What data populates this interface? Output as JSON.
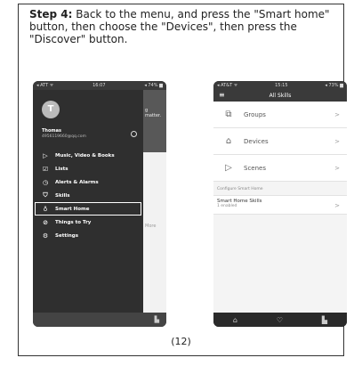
{
  "instruction": {
    "step": "Step 4:",
    "text": " Back to the menu, and press the \"Smart home\" button, then choose the \"Devices\", then press the \"Discover\" button."
  },
  "phone1": {
    "status_left": "◂ ATT ᯤ",
    "status_time": "16:07",
    "status_right": "◂ 74% ▆",
    "avatar_letter": "T",
    "user_name": "Thomas",
    "user_email": "4956119660@qq.com",
    "behind_text": "g matter.",
    "behind_more": "More",
    "menu": [
      {
        "icon": "▷",
        "label": "Music, Video & Books"
      },
      {
        "icon": "☑",
        "label": "Lists"
      },
      {
        "icon": "◷",
        "label": "Alerts & Alarms"
      },
      {
        "icon": "⛉",
        "label": "Skills"
      },
      {
        "icon": "♁",
        "label": "Smart Home"
      },
      {
        "icon": "⊘",
        "label": "Things to Try"
      },
      {
        "icon": "⚙",
        "label": "Settings"
      }
    ],
    "bottom_icon": "▙"
  },
  "phone2": {
    "status_left": "◂ AT&T ᯤ",
    "status_time": "15:15",
    "status_right": "◂ 73% ▆",
    "title": "All Skills",
    "menu_icon": "≡",
    "items": [
      {
        "icon": "⧉",
        "label": "Groups",
        "chev": ">"
      },
      {
        "icon": "⌂",
        "label": "Devices",
        "chev": ">"
      },
      {
        "icon": "▷",
        "label": "Scenes",
        "chev": ">"
      }
    ],
    "section": "Configure Smart Home",
    "smart_title": "Smart Home Skills",
    "smart_sub": "1 enabled",
    "smart_chev": ">",
    "tabs": [
      "⌂",
      "♡",
      "▙"
    ]
  },
  "page_number": "(12)"
}
